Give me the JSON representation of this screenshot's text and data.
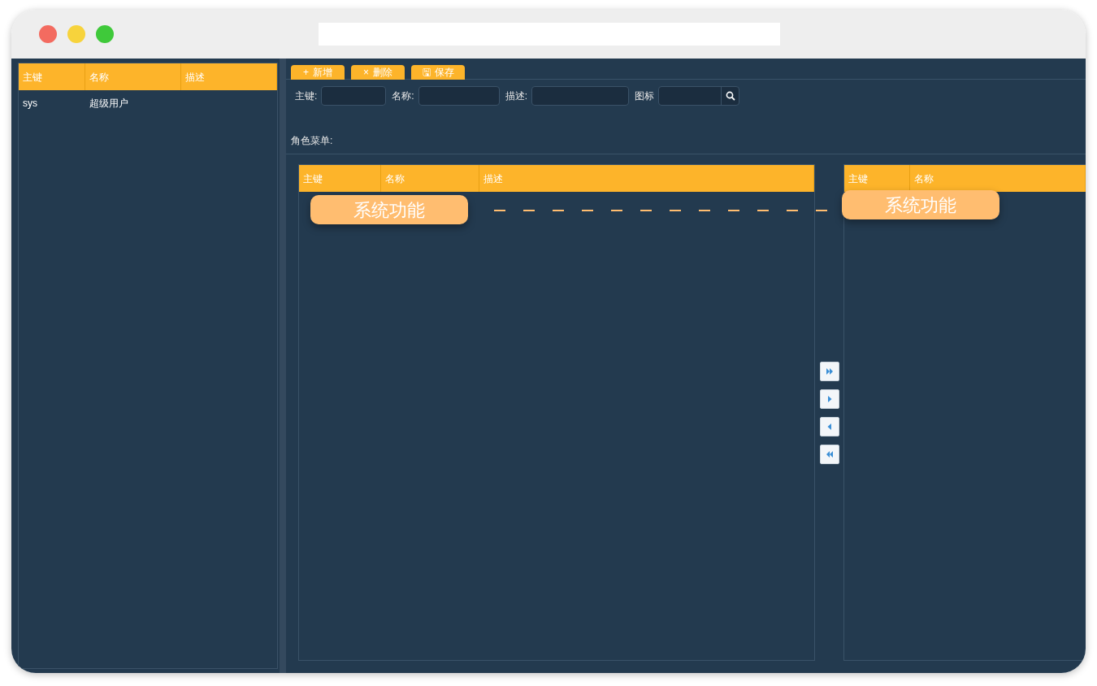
{
  "roles_table": {
    "columns": [
      "主键",
      "名称",
      "描述"
    ],
    "rows": [
      {
        "cells": [
          "sys",
          "超级用户",
          ""
        ],
        "selected": false
      }
    ]
  },
  "toolbar": {
    "buttons": [
      {
        "icon": "+",
        "label": "新增"
      },
      {
        "icon": "×",
        "label": "删除"
      },
      {
        "icon": "🖫",
        "label": "保存"
      }
    ]
  },
  "form": {
    "fields": [
      {
        "kind": "text",
        "label": "主键:"
      },
      {
        "kind": "text",
        "label": "名称:"
      },
      {
        "kind": "text",
        "label": "描述:"
      },
      {
        "kind": "search",
        "label": "图标"
      }
    ]
  },
  "role_menu": {
    "label": "角色菜单:",
    "menu_table": {
      "columns": [
        "主键",
        "名称",
        "描述"
      ]
    },
    "transfer_buttons": [
      {
        "kind": "all_right"
      },
      {
        "kind": "right"
      },
      {
        "kind": "left"
      },
      {
        "kind": "all_left"
      }
    ],
    "selected_table": {
      "columns": [
        "主键",
        "名称"
      ]
    }
  },
  "annotations": [
    {
      "text": "系统功能"
    },
    {
      "text": "系统功能"
    }
  ]
}
